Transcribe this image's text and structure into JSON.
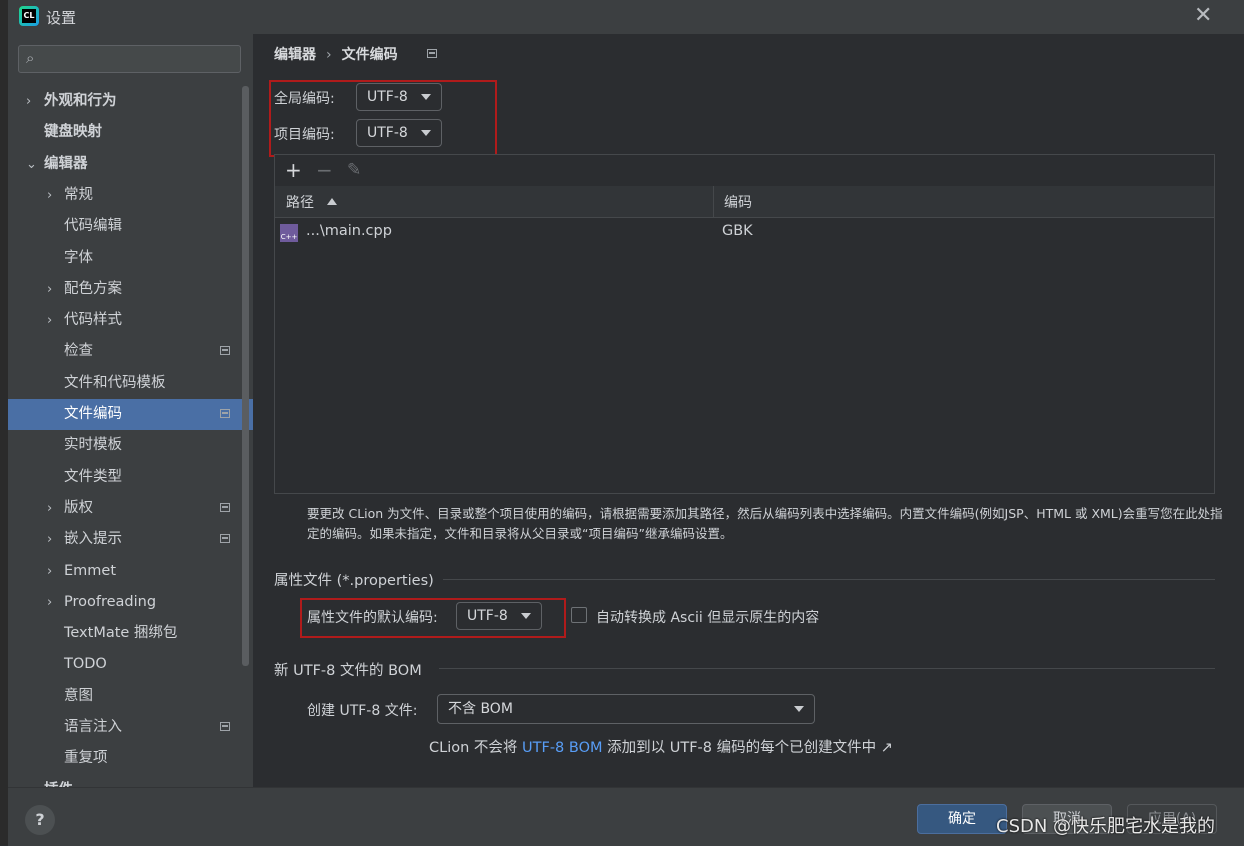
{
  "window": {
    "title": "设置",
    "app_icon": "CL"
  },
  "sidebar": {
    "items": [
      {
        "label": "外观和行为",
        "chev": "›",
        "bold": true
      },
      {
        "label": "键盘映射",
        "chev": "",
        "bold": true
      },
      {
        "label": "编辑器",
        "chev": "⌄",
        "bold": true
      },
      {
        "label": "常规",
        "chev": "›"
      },
      {
        "label": "代码编辑",
        "chev": ""
      },
      {
        "label": "字体",
        "chev": ""
      },
      {
        "label": "配色方案",
        "chev": "›"
      },
      {
        "label": "代码样式",
        "chev": "›"
      },
      {
        "label": "检查",
        "chev": "",
        "sq": true
      },
      {
        "label": "文件和代码模板",
        "chev": ""
      },
      {
        "label": "文件编码",
        "chev": "",
        "sq": true,
        "selected": true
      },
      {
        "label": "实时模板",
        "chev": ""
      },
      {
        "label": "文件类型",
        "chev": ""
      },
      {
        "label": "版权",
        "chev": "›",
        "sq": true
      },
      {
        "label": "嵌入提示",
        "chev": "›",
        "sq": true
      },
      {
        "label": "Emmet",
        "chev": "›"
      },
      {
        "label": "Proofreading",
        "chev": "›"
      },
      {
        "label": "TextMate 捆绑包",
        "chev": ""
      },
      {
        "label": "TODO",
        "chev": ""
      },
      {
        "label": "意图",
        "chev": ""
      },
      {
        "label": "语言注入",
        "chev": "",
        "sq": true
      },
      {
        "label": "重复项",
        "chev": ""
      },
      {
        "label": "插件",
        "chev": "",
        "bold": true
      }
    ]
  },
  "breadcrumb": {
    "part1": "编辑器",
    "sep": "›",
    "part2": "文件编码"
  },
  "encoding": {
    "global_label": "全局编码:",
    "global_value": "UTF-8",
    "project_label": "项目编码:",
    "project_value": "UTF-8"
  },
  "table": {
    "toolbar": {
      "add": "+",
      "remove": "−",
      "edit": "✎"
    },
    "col_path": "路径",
    "col_encoding": "编码",
    "rows": [
      {
        "path": "...\\main.cpp",
        "encoding": "GBK",
        "icon": "C++"
      }
    ]
  },
  "description": "要更改 CLion 为文件、目录或整个项目使用的编码，请根据需要添加其路径，然后从编码列表中选择编码。内置文件编码(例如JSP、HTML 或 XML)会重写您在此处指定的编码。如果未指定，文件和目录将从父目录或“项目编码”继承编码设置。",
  "properties": {
    "section_title": "属性文件 (*.properties)",
    "default_label": "属性文件的默认编码:",
    "default_value": "UTF-8",
    "ascii_checkbox": "自动转换成 Ascii 但显示原生的内容"
  },
  "bom": {
    "section_title": "新 UTF-8 文件的 BOM",
    "create_label": "创建 UTF-8 文件:",
    "create_value": "不含 BOM",
    "note_pre": "CLion 不会将 ",
    "note_link": "UTF-8 BOM",
    "note_post": " 添加到以 UTF-8 编码的每个已创建文件中 ↗"
  },
  "footer": {
    "help": "?",
    "ok": "确定",
    "cancel": "取消",
    "apply": "应用(A)"
  },
  "watermark": "CSDN @快乐肥宅水是我的"
}
